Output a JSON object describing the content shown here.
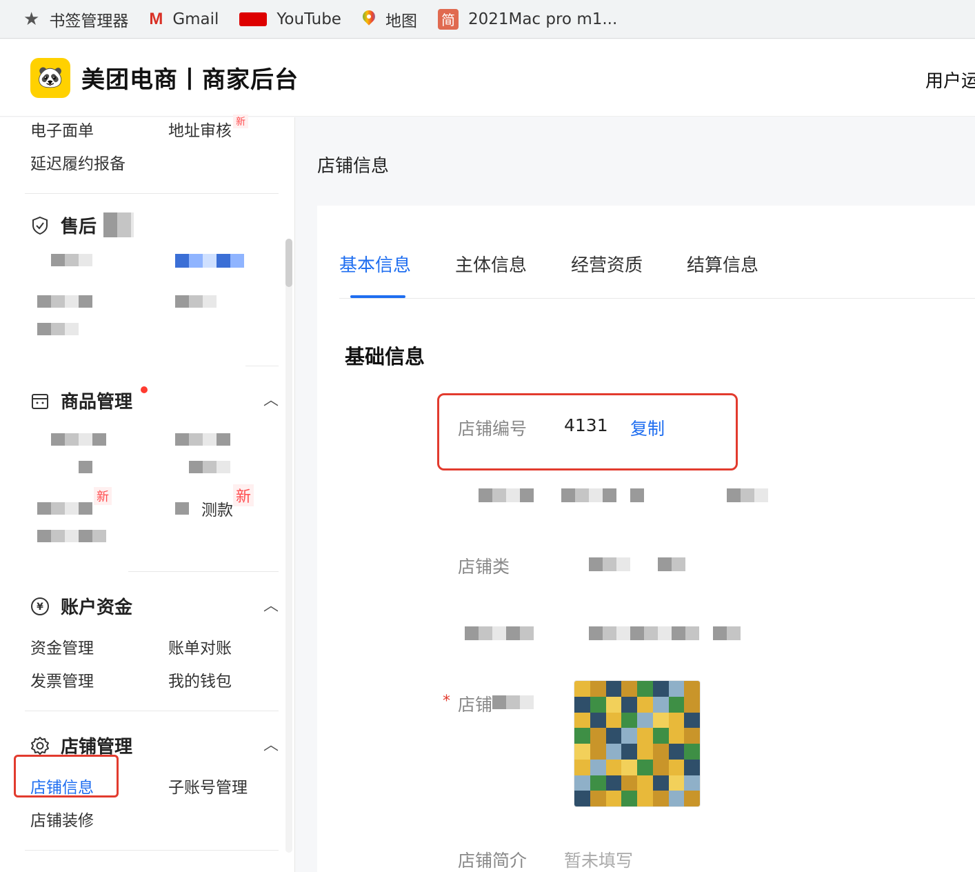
{
  "bookmarks": [
    {
      "label": "书签管理器",
      "icon": "star-icon"
    },
    {
      "label": "Gmail",
      "icon": "gmail-icon"
    },
    {
      "label": "YouTube",
      "icon": "youtube-icon"
    },
    {
      "label": "地图",
      "icon": "maps-icon"
    },
    {
      "label": "2021Mac pro m1...",
      "icon": "jianshu-icon",
      "icon_text": "简"
    }
  ],
  "header": {
    "brand": "美团电商丨商家后台",
    "user_link": "用户运营"
  },
  "sidebar": {
    "top_links": [
      "电子面单",
      "地址审核",
      "延迟履约报备"
    ],
    "new_badge": "新",
    "after_sales": {
      "title_visible": "售后"
    },
    "goods": {
      "title": "商品管理",
      "badge_new_a": "新",
      "badge_new_b": "新",
      "partial_text": "测款"
    },
    "funds": {
      "title": "账户资金",
      "items": [
        "资金管理",
        "账单对账",
        "发票管理",
        "我的钱包"
      ]
    },
    "store": {
      "title": "店铺管理",
      "items": [
        "店铺信息",
        "子账号管理",
        "店铺装修"
      ]
    }
  },
  "main": {
    "page_title": "店铺信息",
    "tabs": [
      "基本信息",
      "主体信息",
      "经营资质",
      "结算信息"
    ],
    "active_tab": 0,
    "section_title": "基础信息",
    "store_id_label": "店铺编号",
    "store_id_value": "4131",
    "copy_label": "复制",
    "store_type_label": "店铺类",
    "store_logo_label": "店铺",
    "intro_label": "店铺简介",
    "intro_value": "暂未填写",
    "required_mark": "*"
  },
  "colors": {
    "accent": "#1f6ef0",
    "highlight": "#e23b2e",
    "brand_yellow": "#ffd100"
  }
}
